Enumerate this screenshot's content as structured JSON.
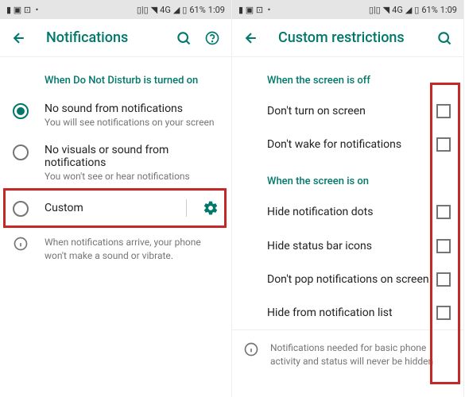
{
  "status_bar": {
    "battery": "61%",
    "time": "1:09",
    "signal_label": "4G"
  },
  "left": {
    "title": "Notifications",
    "section_header": "When Do Not Disturb is turned on",
    "options": [
      {
        "title": "No sound from notifications",
        "sub": "You will see notifications on your screen"
      },
      {
        "title": "No visuals or sound from notifications",
        "sub": "You won't see or hear notifications"
      },
      {
        "title": "Custom"
      }
    ],
    "info_text": "When notifications arrive, your phone won't make a sound or vibrate."
  },
  "right": {
    "title": "Custom restrictions",
    "section_off": "When the screen is off",
    "off_items": [
      "Don't turn on screen",
      "Don't wake for notifications"
    ],
    "section_on": "When the screen is on",
    "on_items": [
      "Hide notification dots",
      "Hide status bar icons",
      "Don't pop notifications on screen",
      "Hide from notification list"
    ],
    "footer_info": "Notifications needed for basic phone activity and status will never be hidden"
  }
}
